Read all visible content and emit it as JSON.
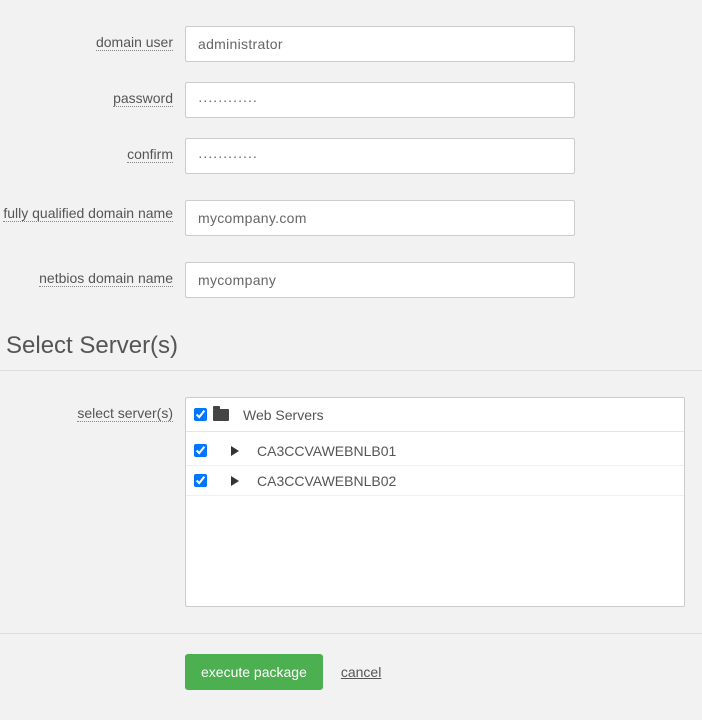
{
  "form": {
    "domain_user": {
      "label": "domain user",
      "value": "administrator"
    },
    "password": {
      "label": "password",
      "value": "············"
    },
    "confirm": {
      "label": "confirm",
      "value": "············"
    },
    "fqdn": {
      "label": "fully qualified domain name",
      "value": "mycompany.com"
    },
    "netbios": {
      "label": "netbios domain name",
      "value": "mycompany"
    }
  },
  "section_head": "Select Server(s)",
  "servers": {
    "label": "select server(s)",
    "group_name": "Web Servers",
    "group_checked": true,
    "items": [
      {
        "name": "CA3CCVAWEBNLB01",
        "checked": true
      },
      {
        "name": "CA3CCVAWEBNLB02",
        "checked": true
      }
    ]
  },
  "actions": {
    "execute": "execute package",
    "cancel": "cancel"
  }
}
